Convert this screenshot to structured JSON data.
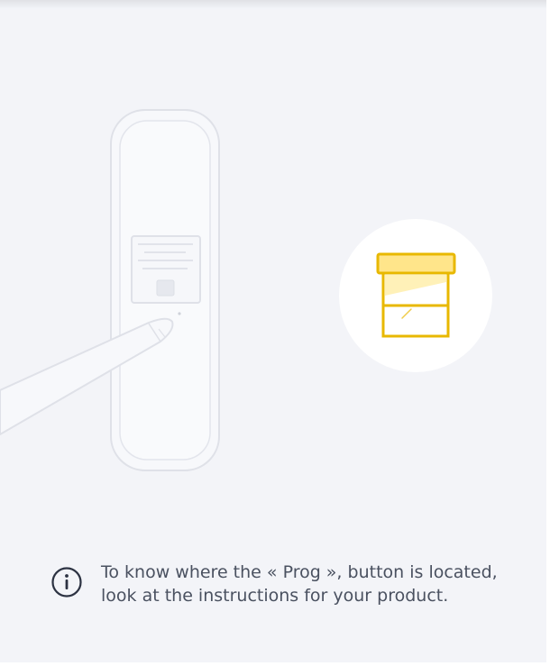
{
  "info": {
    "icon": "info-circle-icon",
    "text": "To know where the « Prog », button is located, look at the instructions for your product."
  },
  "colors": {
    "background": "#f3f4f8",
    "accent": "#e8b800",
    "accent_light": "#fff1b8",
    "device_outline": "#dfe1e8",
    "text": "#4a5160",
    "icon_dark": "#2c3242"
  },
  "illustration": {
    "device": "wall-remote-icon",
    "pen": "stylus-pen-icon",
    "product": "box-icon"
  }
}
